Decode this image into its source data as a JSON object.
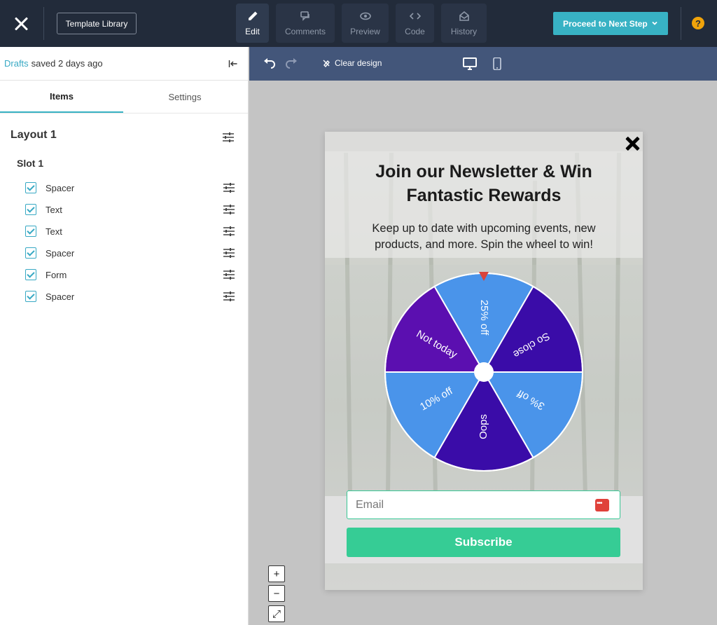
{
  "topbar": {
    "template_library": "Template Library",
    "modes": [
      {
        "label": "Edit",
        "icon": "pencil-icon"
      },
      {
        "label": "Comments",
        "icon": "comments-icon"
      },
      {
        "label": "Preview",
        "icon": "eye-icon"
      },
      {
        "label": "Code",
        "icon": "code-icon"
      },
      {
        "label": "History",
        "icon": "envelope-open-icon"
      }
    ],
    "active_mode": "Edit",
    "proceed_label": "Proceed to Next Step",
    "help": "?"
  },
  "sidebar": {
    "drafts_link": "Drafts",
    "saved_text": "saved 2 days ago",
    "tabs": [
      "Items",
      "Settings"
    ],
    "active_tab": "Items",
    "layout_title": "Layout 1",
    "slot_title": "Slot 1",
    "items": [
      {
        "label": "Spacer",
        "checked": true
      },
      {
        "label": "Text",
        "checked": true
      },
      {
        "label": "Text",
        "checked": true
      },
      {
        "label": "Spacer",
        "checked": true
      },
      {
        "label": "Form",
        "checked": true
      },
      {
        "label": "Spacer",
        "checked": true
      }
    ]
  },
  "canvas_toolbar": {
    "clear_design": "Clear design"
  },
  "popup": {
    "title": "Join our Newsletter & Win Fantastic Rewards",
    "subtitle": "Keep up to date with upcoming events, new products, and more. Spin the wheel to win!",
    "wheel_segments": [
      {
        "label": "25% off",
        "color": "#4a94ea"
      },
      {
        "label": "So close",
        "color": "#3a0ca8"
      },
      {
        "label": "3% off",
        "color": "#4a94ea"
      },
      {
        "label": "Oops",
        "color": "#3a0ca8"
      },
      {
        "label": "10% off",
        "color": "#4a94ea"
      },
      {
        "label": "Not today",
        "color": "#5b0fb0"
      }
    ],
    "email_placeholder": "Email",
    "subscribe_label": "Subscribe"
  },
  "zoom": [
    "+",
    "−",
    "⤢"
  ],
  "colors": {
    "topbar_bg": "#222b3a",
    "accent": "#38b2c4",
    "toolbar_bg": "#43567a",
    "subscribe": "#36cc95",
    "pointer": "#d9443b"
  }
}
